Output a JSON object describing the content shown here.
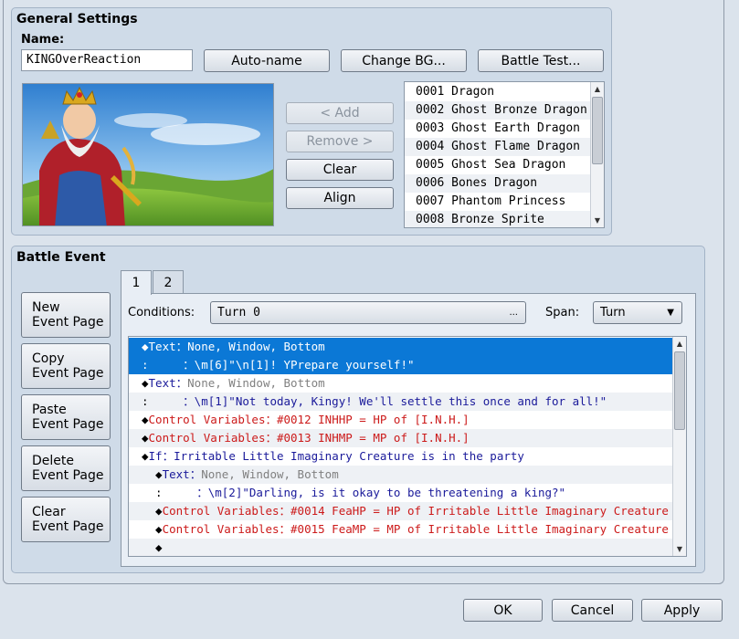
{
  "general": {
    "title": "General Settings",
    "name_label": "Name:",
    "name_value": "KINGOverReaction",
    "autoname": "Auto-name",
    "change_bg": "Change BG...",
    "battle_test": "Battle Test...",
    "add": "< Add",
    "remove": "Remove >",
    "clear": "Clear",
    "align": "Align",
    "troops": [
      "0001 Dragon",
      "0002 Ghost Bronze Dragon",
      "0003 Ghost Earth Dragon",
      "0004 Ghost Flame Dragon",
      "0005 Ghost Sea Dragon",
      "0006 Bones Dragon",
      "0007 Phantom Princess",
      "0008 Bronze Sprite"
    ]
  },
  "battle": {
    "title": "Battle Event",
    "new_page_1": "New",
    "new_page_2": "Event Page",
    "copy_page_1": "Copy",
    "copy_page_2": "Event Page",
    "paste_page_1": "Paste",
    "paste_page_2": "Event Page",
    "delete_page_1": "Delete",
    "delete_page_2": "Event Page",
    "clear_page_1": "Clear",
    "clear_page_2": "Event Page",
    "tabs": [
      "1",
      "2"
    ],
    "conditions_label": "Conditions:",
    "conditions_value": "Turn 0",
    "conditions_btn": "...",
    "span_label": "Span:",
    "span_value": "Turn",
    "events": [
      {
        "pre": "◆",
        "cmd": "Text",
        "sep": "：",
        "args": "None, Window, Bottom"
      },
      {
        "pre": ":     ",
        "cmd": "",
        "sep": "：",
        "args": "\\m[6]\"\\n[1]! YPrepare yourself!\""
      },
      {
        "pre": "◆",
        "cmd": "Text",
        "sep": "：",
        "args": "None, Window, Bottom"
      },
      {
        "pre": ":     ",
        "cmd": "",
        "sep": "：",
        "args": "\\m[1]\"Not today, Kingy! We'll settle this once and for all!\""
      },
      {
        "pre": "◆",
        "cmd": "Control Variables",
        "sep": "：",
        "args": "#0012 INHHP = HP of [I.N.H.]"
      },
      {
        "pre": "◆",
        "cmd": "Control Variables",
        "sep": "：",
        "args": "#0013 INHMP = MP of [I.N.H.]"
      },
      {
        "pre": "◆",
        "cmd": "If",
        "sep": "：",
        "args": "Irritable Little Imaginary Creature is in the party"
      },
      {
        "pre": "  ◆",
        "cmd": "Text",
        "sep": "：",
        "args": "None, Window, Bottom"
      },
      {
        "pre": "  :     ",
        "cmd": "",
        "sep": "：",
        "args": "\\m[2]\"Darling, is it okay to be threatening a king?\""
      },
      {
        "pre": "  ◆",
        "cmd": "Control Variables",
        "sep": "：",
        "args": "#0014 FeaHP = HP of Irritable Little Imaginary Creature"
      },
      {
        "pre": "  ◆",
        "cmd": "Control Variables",
        "sep": "：",
        "args": "#0015 FeaMP = MP of Irritable Little Imaginary Creature"
      },
      {
        "pre": "  ◆",
        "cmd": "",
        "sep": "",
        "args": ""
      }
    ]
  },
  "footer": {
    "ok": "OK",
    "cancel": "Cancel",
    "apply": "Apply"
  }
}
